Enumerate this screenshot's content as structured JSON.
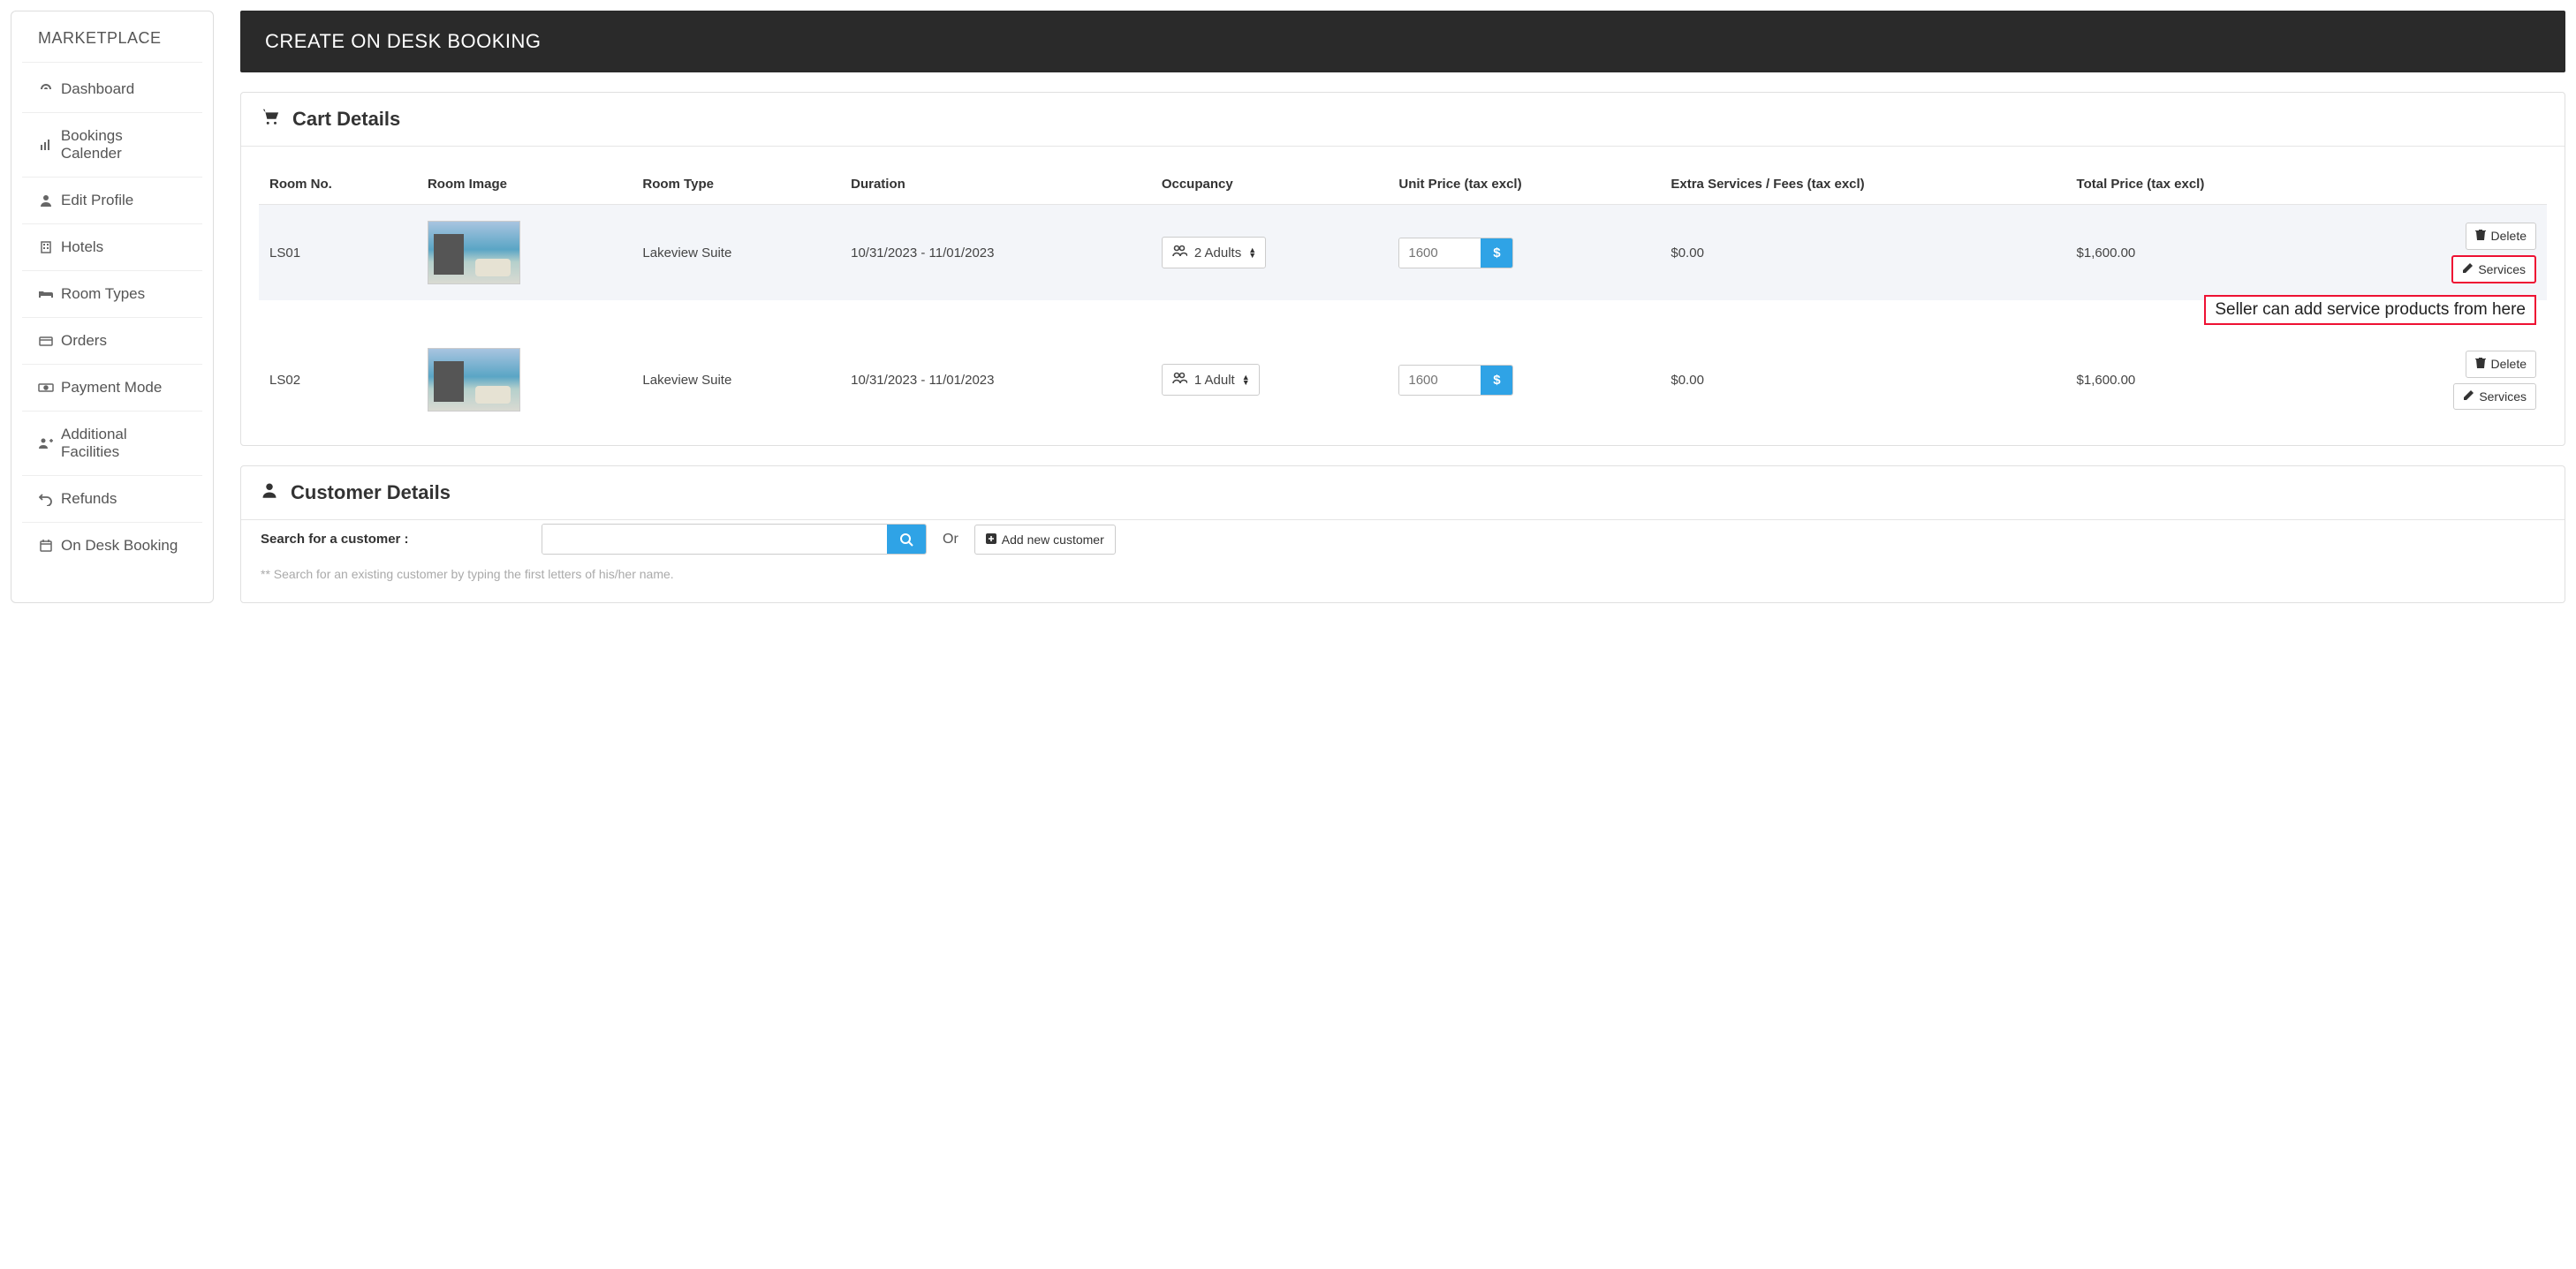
{
  "sidebar": {
    "title": "MARKETPLACE",
    "items": [
      {
        "label": "Dashboard",
        "icon": "dashboard-icon"
      },
      {
        "label": "Bookings Calender",
        "icon": "chart-icon"
      },
      {
        "label": "Edit Profile",
        "icon": "user-icon"
      },
      {
        "label": "Hotels",
        "icon": "building-icon"
      },
      {
        "label": "Room Types",
        "icon": "bed-icon"
      },
      {
        "label": "Orders",
        "icon": "card-icon"
      },
      {
        "label": "Payment Mode",
        "icon": "money-icon"
      },
      {
        "label": "Additional Facilities",
        "icon": "users-plus-icon"
      },
      {
        "label": "Refunds",
        "icon": "undo-icon"
      },
      {
        "label": "On Desk Booking",
        "icon": "calendar-icon"
      }
    ]
  },
  "page": {
    "title": "CREATE ON DESK BOOKING"
  },
  "cart": {
    "title": "Cart Details",
    "columns": {
      "room_no": "Room No.",
      "room_image": "Room Image",
      "room_type": "Room Type",
      "duration": "Duration",
      "occupancy": "Occupancy",
      "unit_price": "Unit Price (tax excl)",
      "extra": "Extra Services / Fees (tax excl)",
      "total": "Total Price (tax excl)"
    },
    "rows": [
      {
        "room_no": "LS01",
        "room_type": "Lakeview Suite",
        "duration": "10/31/2023 - 11/01/2023",
        "occupancy": "2 Adults",
        "unit_price": "1600",
        "extra": "$0.00",
        "total": "$1,600.00"
      },
      {
        "room_no": "LS02",
        "room_type": "Lakeview Suite",
        "duration": "10/31/2023 - 11/01/2023",
        "occupancy": "1 Adult",
        "unit_price": "1600",
        "extra": "$0.00",
        "total": "$1,600.00"
      }
    ],
    "actions": {
      "delete": "Delete",
      "services": "Services"
    },
    "annotation": "Seller can add service products from here"
  },
  "customer": {
    "title": "Customer Details",
    "search_label": "Search for a customer :",
    "or": "Or",
    "add_button": "Add new customer",
    "hint": "** Search for an existing customer by typing the first letters of his/her name."
  }
}
